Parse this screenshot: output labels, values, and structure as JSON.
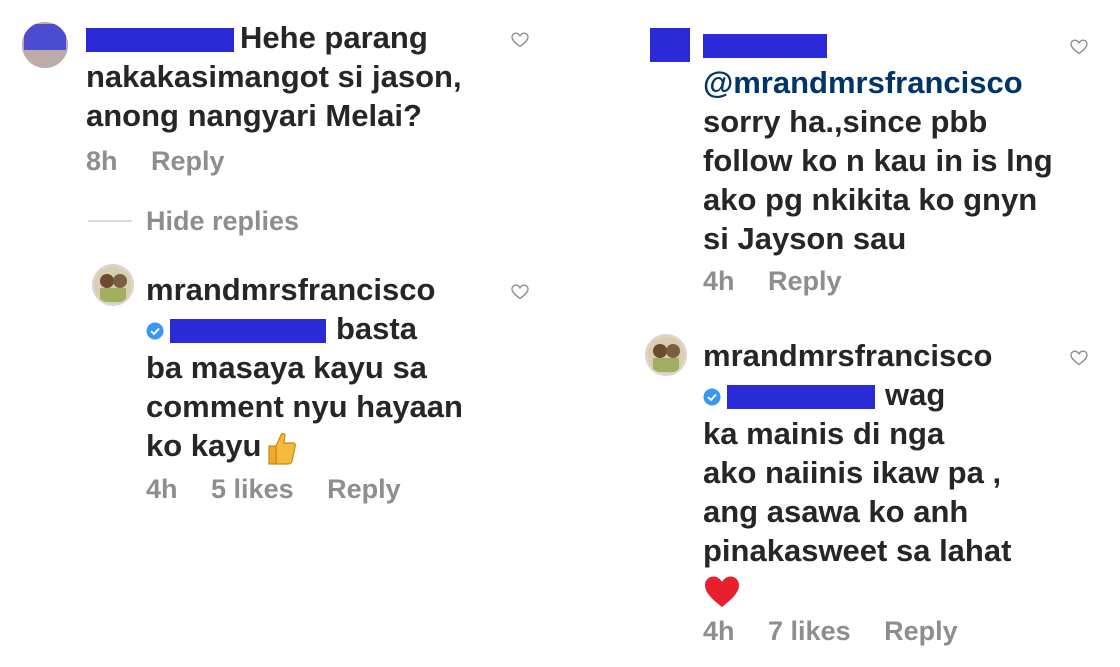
{
  "left": {
    "comment1": {
      "text": "Hehe parang nakakasimangot si jason, anong nangyari Melai?",
      "line1": "Hehe parang",
      "line2": "nakakasimangot si jason,",
      "line3": "anong nangyari Melai?",
      "time": "8h",
      "reply": "Reply"
    },
    "hide_replies": "Hide replies",
    "reply1": {
      "username": "mrandmrsfrancisco",
      "line1_tail": "basta",
      "line2": "ba masaya kayu sa",
      "line3": "comment nyu hayaan",
      "line4": "ko kayu",
      "emoji_icon": "thumbs-up-icon",
      "time": "4h",
      "likes": "5 likes",
      "reply": "Reply"
    }
  },
  "right": {
    "comment1": {
      "mention": "@mrandmrsfrancisco",
      "line2": "sorry ha.,since pbb",
      "line3": "follow ko n kau in is lng",
      "line4": "ako pg nkikita ko gnyn",
      "line5": "si Jayson sau",
      "time": "4h",
      "reply": "Reply"
    },
    "reply1": {
      "username": "mrandmrsfrancisco",
      "line1_tail": "wag",
      "line2": "ka mainis di nga",
      "line3": "ako naiinis ikaw pa ,",
      "line4": "ang asawa ko anh",
      "line5": "pinakasweet sa lahat",
      "emoji_icon": "red-heart-icon",
      "time": "4h",
      "likes": "7 likes",
      "reply": "Reply"
    }
  },
  "colors": {
    "text": "#262626",
    "meta": "#8e8e8e",
    "mention": "#003569",
    "redaction": "#2a2ad6",
    "verified": "#3897f0",
    "heart_red": "#ed4956"
  }
}
